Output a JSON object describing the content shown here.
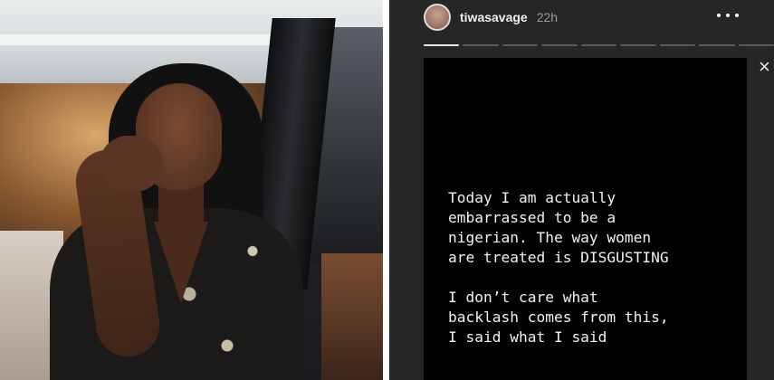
{
  "photo": {
    "alt": "Woman in patterned dress posing in a car doorway"
  },
  "story": {
    "username": "tiwasavage",
    "time": "22h",
    "more_icon": "more-horizontal-icon",
    "close_icon": "close-icon",
    "close_glyph": "×",
    "progress_segments": 9,
    "active_segment": 0,
    "text": "Today I am actually\nembarrassed to be a\nnigerian. The way women\nare treated is DISGUSTING\n\nI don’t care what\nbacklash comes from this,\nI said what I said"
  }
}
